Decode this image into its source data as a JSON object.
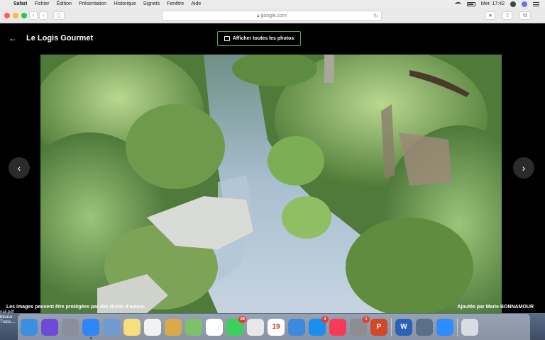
{
  "menubar": {
    "app": "Safari",
    "items": [
      "Fichier",
      "Édition",
      "Présentation",
      "Historique",
      "Signets",
      "Fenêtre",
      "Aide"
    ],
    "clock": "Mer. 17:42"
  },
  "browser": {
    "url": "google.com",
    "lock_icon": "lock-icon",
    "reload_icon": "reload-icon"
  },
  "gallery": {
    "title": "Le Logis Gourmet",
    "show_all_label": "Afficher toutes les photos",
    "caption_left": "Les images peuvent être protégées par des droits d'auteur.",
    "caption_right": "Ajoutée par Marie BONNAMOUR",
    "back_icon": "arrow-left-icon",
    "prev_icon": "chevron-left-icon",
    "next_icon": "chevron-right-icon"
  },
  "desktop": {
    "files": [
      "nail.pdf",
      "bleaux -",
      "Trace...."
    ]
  },
  "dock": {
    "items": [
      {
        "name": "finder",
        "color": "#3b8fe0"
      },
      {
        "name": "siri",
        "color": "#6d4bd8"
      },
      {
        "name": "launchpad",
        "color": "#8a8f99"
      },
      {
        "name": "safari",
        "color": "#2f86f6",
        "running": true
      },
      {
        "name": "preview",
        "color": "#6f9bd1"
      },
      {
        "name": "notes",
        "color": "#f7e07a"
      },
      {
        "name": "textedit",
        "color": "#f2f2f2"
      },
      {
        "name": "notefile",
        "color": "#d9a94a"
      },
      {
        "name": "maps",
        "color": "#7fc06a"
      },
      {
        "name": "photos",
        "color": "#ffffff"
      },
      {
        "name": "messages",
        "color": "#3ecf5a",
        "badge": "28"
      },
      {
        "name": "script-editor",
        "color": "#e8e8e8"
      },
      {
        "name": "calendar",
        "color": "#ffffff",
        "label": "19"
      },
      {
        "name": "keynote",
        "color": "#3c8ae0"
      },
      {
        "name": "app-store",
        "color": "#1c8ef0",
        "badge": "4"
      },
      {
        "name": "music",
        "color": "#fb3a57"
      },
      {
        "name": "system-preferences",
        "color": "#8d8d8d",
        "badge": "1"
      },
      {
        "name": "powerpoint",
        "color": "#d24726",
        "label": "P"
      },
      {
        "name": "word",
        "color": "#2b62b8",
        "label": "W"
      },
      {
        "name": "screenshot",
        "color": "#5a6f8a"
      },
      {
        "name": "zoom",
        "color": "#2d8cff"
      },
      {
        "name": "trash",
        "color": "#d8dde3"
      }
    ]
  }
}
